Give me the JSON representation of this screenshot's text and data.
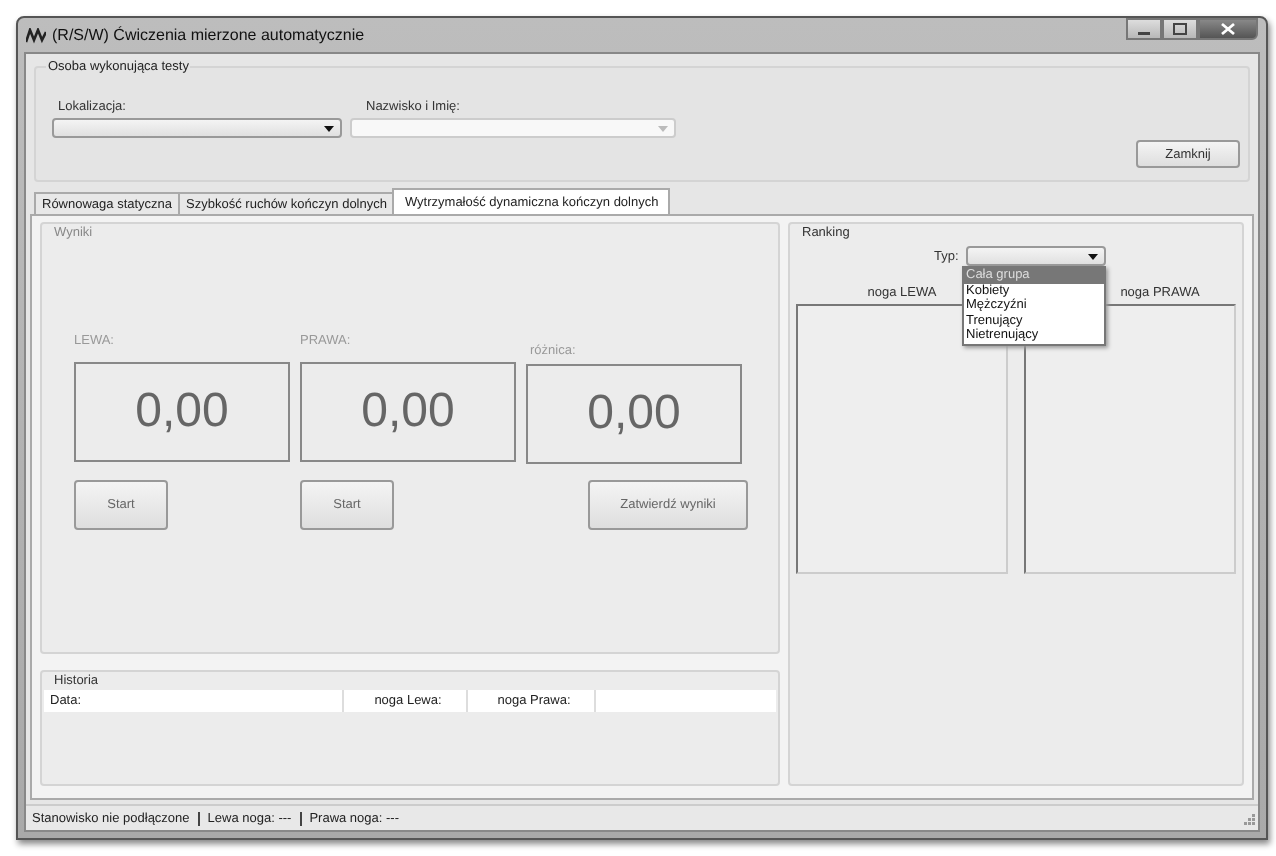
{
  "window": {
    "title": "(R/S/W) Ćwiczenia mierzone automatycznie"
  },
  "person": {
    "title": "Osoba wykonująca testy",
    "location": {
      "label": "Lokalizacja:"
    },
    "name": {
      "label": "Nazwisko i Imię:",
      "disabled": true
    },
    "close_button": "Zamknij"
  },
  "tabs": [
    {
      "label": "Równowaga statyczna",
      "selected": false
    },
    {
      "label": "Szybkość ruchów kończyn dolnych",
      "selected": false
    },
    {
      "label": "Wytrzymałość dynamiczna kończyn dolnych",
      "selected": true
    }
  ],
  "results": {
    "title": "Wyniki",
    "readouts": [
      {
        "label": "LEWA:",
        "value": "0,00"
      },
      {
        "label": "PRAWA:",
        "value": "0,00"
      },
      {
        "label": "różnica:",
        "value": "0,00"
      }
    ],
    "buttons": [
      "Start",
      "Start",
      "Zatwierdź wyniki"
    ]
  },
  "history": {
    "title": "Historia",
    "columns": [
      "Data:",
      "noga Lewa:",
      "noga Prawa:"
    ]
  },
  "ranking": {
    "title": "Ranking",
    "type_label": "Typ:",
    "type_options": [
      {
        "label": "Cała grupa",
        "selected": true
      },
      {
        "label": "Kobiety",
        "selected": false
      },
      {
        "label": "Mężczyźni",
        "selected": false
      },
      {
        "label": "Trenujący",
        "selected": false
      },
      {
        "label": "Nietrenujący",
        "selected": false
      }
    ],
    "columns": [
      "noga LEWA",
      "noga PRAWA"
    ]
  },
  "status_bar": [
    "Stanowisko nie podłączone",
    "Lewa noga: ---",
    "Prawa noga: ---"
  ]
}
